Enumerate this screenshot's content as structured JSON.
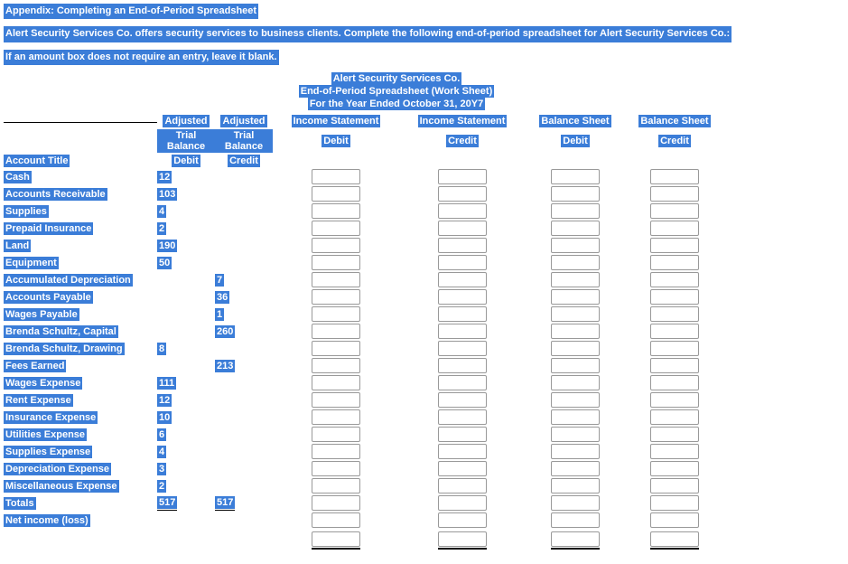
{
  "instructions": {
    "line1": "Appendix: Completing an End-of-Period Spreadsheet",
    "line2": "Alert Security Services Co. offers security services to business clients. Complete the following end-of-period spreadsheet for Alert Security Services Co.:",
    "line3": "If an amount box does not require an entry, leave it blank."
  },
  "title": {
    "company": "Alert Security Services Co.",
    "doc": "End-of-Period Spreadsheet (Work Sheet)",
    "period": "For the Year Ended October 31, 20Y7"
  },
  "headers": {
    "account": "Account Title",
    "atb_debit_l1": "Adjusted",
    "atb_debit_l2": "Trial Balance",
    "atb_debit_l3": "Debit",
    "atb_credit_l1": "Adjusted",
    "atb_credit_l2": "Trial Balance",
    "atb_credit_l3": "Credit",
    "is_debit_l1": "Income Statement",
    "is_debit_l2": "Debit",
    "is_credit_l1": "Income Statement",
    "is_credit_l2": "Credit",
    "bs_debit_l1": "Balance Sheet",
    "bs_debit_l2": "Debit",
    "bs_credit_l1": "Balance Sheet",
    "bs_credit_l2": "Credit"
  },
  "rows": [
    {
      "title": "Cash",
      "debit": "12",
      "credit": ""
    },
    {
      "title": "Accounts Receivable",
      "debit": "103",
      "credit": ""
    },
    {
      "title": "Supplies",
      "debit": "4",
      "credit": ""
    },
    {
      "title": "Prepaid Insurance",
      "debit": "2",
      "credit": ""
    },
    {
      "title": "Land",
      "debit": "190",
      "credit": ""
    },
    {
      "title": "Equipment",
      "debit": "50",
      "credit": ""
    },
    {
      "title": "Accumulated Depreciation",
      "debit": "",
      "credit": "7"
    },
    {
      "title": "Accounts Payable",
      "debit": "",
      "credit": "36"
    },
    {
      "title": "Wages Payable",
      "debit": "",
      "credit": "1"
    },
    {
      "title": "Brenda Schultz, Capital",
      "debit": "",
      "credit": "260"
    },
    {
      "title": "Brenda Schultz, Drawing",
      "debit": "8",
      "credit": ""
    },
    {
      "title": "Fees Earned",
      "debit": "",
      "credit": "213"
    },
    {
      "title": "Wages Expense",
      "debit": "111",
      "credit": ""
    },
    {
      "title": "Rent Expense",
      "debit": "12",
      "credit": ""
    },
    {
      "title": "Insurance Expense",
      "debit": "10",
      "credit": ""
    },
    {
      "title": "Utilities Expense",
      "debit": "6",
      "credit": ""
    },
    {
      "title": "Supplies Expense",
      "debit": "4",
      "credit": ""
    },
    {
      "title": "Depreciation Expense",
      "debit": "3",
      "credit": ""
    },
    {
      "title": "Miscellaneous Expense",
      "debit": "2",
      "credit": ""
    }
  ],
  "totals": {
    "title": "Totals",
    "debit": "517",
    "credit": "517"
  },
  "net": {
    "title": "Net income (loss)"
  }
}
